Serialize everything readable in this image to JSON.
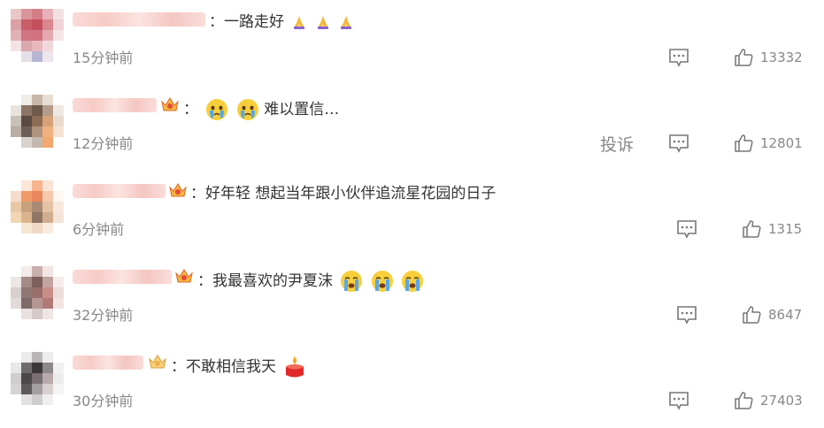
{
  "comments": [
    {
      "separator": "：",
      "text": "一路走好",
      "emojis": [
        "pray-icon",
        "pray-icon",
        "pray-icon"
      ],
      "time": "15分钟前",
      "likes": "13332"
    },
    {
      "separator": "：",
      "text": "难以置信…",
      "emojis_before": [
        "crying-face-icon",
        "crying-face-icon"
      ],
      "time": "12分钟前",
      "likes": "12801",
      "report": "投诉"
    },
    {
      "separator": "：",
      "text": "好年轻 想起当年跟小伙伴追流星花园的日子",
      "time": "6分钟前",
      "likes": "1315"
    },
    {
      "separator": "：",
      "text": "我最喜欢的尹夏沫",
      "emojis": [
        "loudly-crying-icon",
        "loudly-crying-icon",
        "loudly-crying-icon"
      ],
      "time": "32分钟前",
      "likes": "8647"
    },
    {
      "separator": "：",
      "text": "不敢相信我天",
      "emojis": [
        "candle-icon"
      ],
      "time": "30分钟前",
      "likes": "27403"
    }
  ],
  "colors": {
    "text": "#333333",
    "meta": "#888888",
    "icon": "#777777"
  }
}
